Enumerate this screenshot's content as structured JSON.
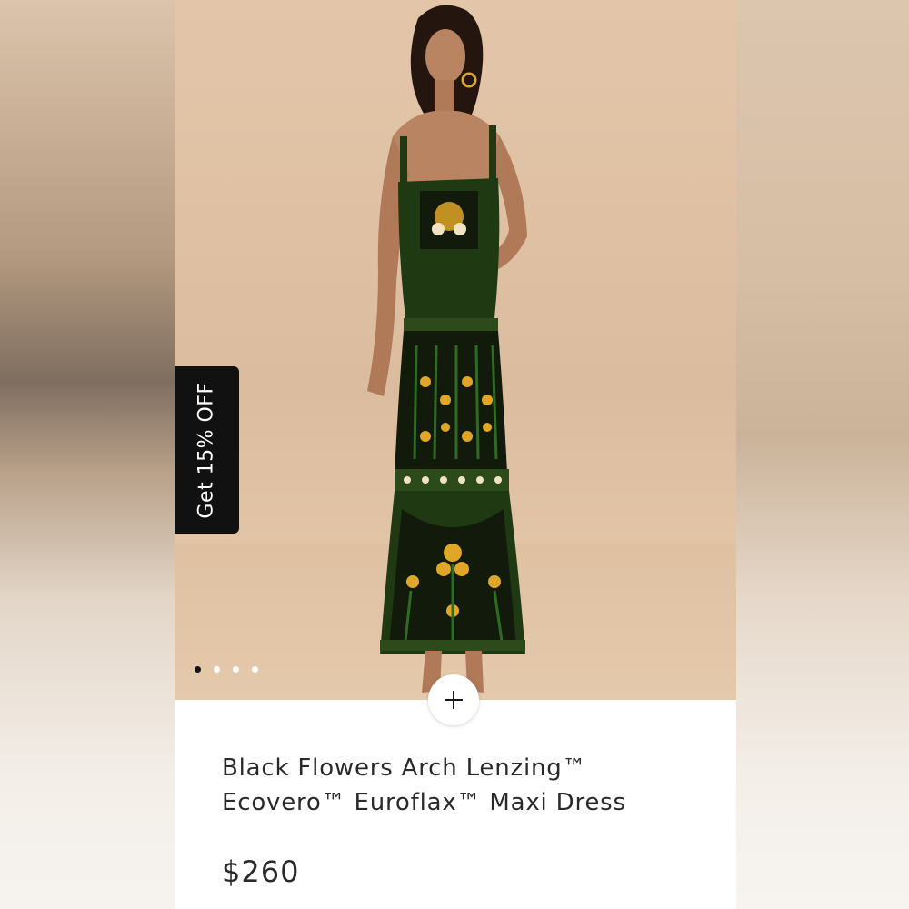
{
  "promo": {
    "label": "Get 15% OFF"
  },
  "gallery": {
    "total_images": 4,
    "active_index": 0
  },
  "actions": {
    "add_icon": "plus-icon"
  },
  "product": {
    "title_line1": "Black Flowers Arch Lenzing™",
    "title_line2": "Ecovero™ Euroflax™ Maxi Dress",
    "price": "$260"
  },
  "colors": {
    "background": "#dcbc9e",
    "promo_bg": "#111111",
    "text": "#2a2a2a",
    "dress_green": "#1f3a12",
    "dress_black": "#121a0c",
    "accent_yellow": "#e0a628"
  }
}
